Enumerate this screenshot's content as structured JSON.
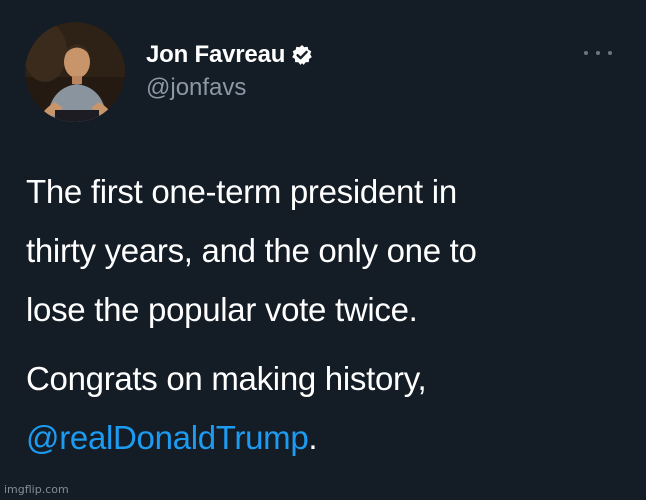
{
  "tweet": {
    "author": {
      "display_name": "Jon Favreau",
      "handle": "@jonfavs",
      "verified": true,
      "avatar_icon": "profile-photo",
      "verified_icon": "verified-badge-icon"
    },
    "menu_icon": "more-options-icon",
    "body": {
      "line_1": "The first one-term president in",
      "line_2": "thirty years, and the only one to",
      "line_3": "lose the popular vote twice.",
      "line_4": "Congrats on making history,",
      "mention": "@realDonaldTrump",
      "trailing": "."
    }
  },
  "watermark": "imgflip.com",
  "colors": {
    "background": "#141c26",
    "text": "#ffffff",
    "secondary_text": "#8b98a5",
    "mention": "#1d9bf0",
    "verified_badge": "#ffffff"
  }
}
